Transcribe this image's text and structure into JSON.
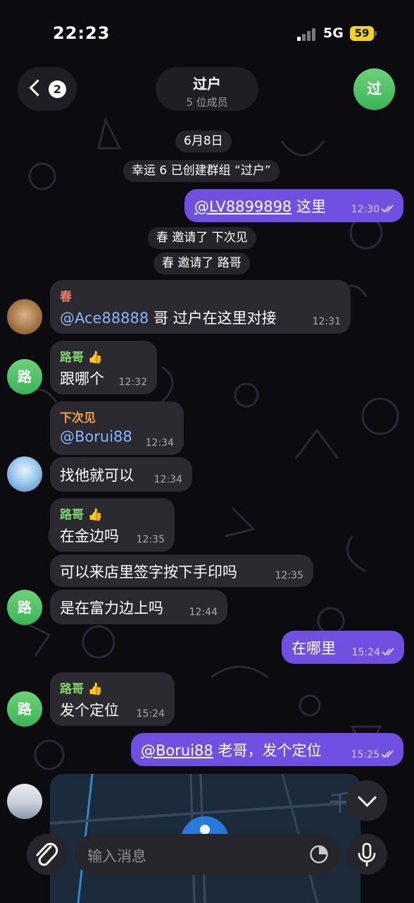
{
  "status_bar": {
    "time": "22:23",
    "network": "5G",
    "battery": "59"
  },
  "header": {
    "back_count": "2",
    "title": "过户",
    "subtitle": "5 位成员",
    "avatar_letter": "过"
  },
  "service": {
    "date": "6月8日",
    "created": "幸运 6 已创建群组 “过户”",
    "invite1": "春 邀请了 下次见",
    "invite2": "春 邀请了 路哥"
  },
  "messages": {
    "m1": {
      "mention": "@LV8899898",
      "text": " 这里",
      "time": "12:30"
    },
    "m2": {
      "sender": "春",
      "mention": "@Ace88888",
      "text": " 哥 过户在这里对接",
      "time": "12:31"
    },
    "m3": {
      "sender": "路哥 👍",
      "text": "跟哪个",
      "time": "12:32"
    },
    "m4": {
      "sender": "下次见",
      "mention": "@Borui88",
      "time": "12:34"
    },
    "m5": {
      "text": "找他就可以",
      "time": "12:34"
    },
    "m6": {
      "sender": "路哥 👍",
      "text": "在金边吗",
      "time": "12:35"
    },
    "m7": {
      "text": "可以来店里签字按下手印吗",
      "time": "12:35"
    },
    "m8": {
      "text": "是在富力边上吗",
      "time": "12:44"
    },
    "m9": {
      "text": "在哪里",
      "time": "15:24"
    },
    "m10": {
      "sender": "路哥 👍",
      "text": "发个定位",
      "time": "15:24"
    },
    "m11": {
      "mention": "@Borui88",
      "text": " 老哥，发个定位",
      "time": "15:25"
    }
  },
  "avatars": {
    "lu": "路"
  },
  "composer": {
    "placeholder": "输入消息"
  },
  "colors": {
    "outgoing_bubble": "#6f50e0",
    "incoming_bubble": "#2b2a31",
    "sender_chun": "#ee7b6a",
    "sender_lu": "#7fd56a",
    "sender_xia": "#f0a24a",
    "mention": "#8ab4ff"
  }
}
